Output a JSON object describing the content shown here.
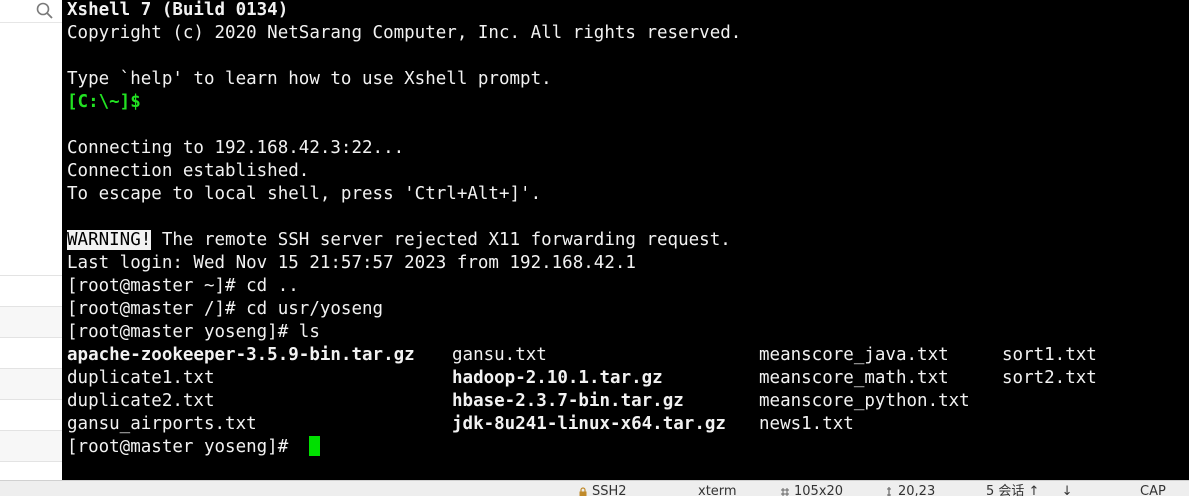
{
  "side_panel": {
    "search_icon": "search-icon"
  },
  "terminal": {
    "lines": [
      {
        "text": "Xshell 7 (Build 0134)"
      },
      {
        "text": "Copyright (c) 2020 NetSarang Computer, Inc. All rights reserved."
      },
      {
        "text": ""
      },
      {
        "text": "Type `help' to learn how to use Xshell prompt."
      },
      {
        "text": "[C:\\~]$"
      },
      {
        "text": ""
      },
      {
        "text": "Connecting to 192.168.42.3:22..."
      },
      {
        "text": "Connection established."
      },
      {
        "text": "To escape to local shell, press 'Ctrl+Alt+]'."
      },
      {
        "text": ""
      },
      {
        "warning": "WARNING!",
        "text": " The remote SSH server rejected X11 forwarding request."
      },
      {
        "text": "Last login: Wed Nov 15 21:57:57 2023 from 192.168.42.1"
      },
      {
        "text": "[root@master ~]# cd .."
      },
      {
        "text": "[root@master /]# cd usr/yoseng"
      },
      {
        "text": "[root@master yoseng]# ls"
      }
    ],
    "ls_output": {
      "col1": [
        "apache-zookeeper-3.5.9-bin.tar.gz",
        "duplicate1.txt",
        "duplicate2.txt",
        "gansu_airports.txt"
      ],
      "col2": [
        "gansu.txt",
        "hadoop-2.10.1.tar.gz",
        "hbase-2.3.7-bin.tar.gz",
        "jdk-8u241-linux-x64.tar.gz"
      ],
      "col3": [
        "meanscore_java.txt",
        "meanscore_math.txt",
        "meanscore_python.txt",
        "news1.txt"
      ],
      "col4": [
        "sort1.txt",
        "sort2.txt"
      ]
    },
    "final_prompt": "[root@master yoseng]# ",
    "colors": {
      "background": "#000000",
      "foreground": "#f2f2f2",
      "prompt_green": "#22e222",
      "archive_red": "#ff4040",
      "cursor": "#00e000"
    }
  },
  "status_bar": {
    "items": [
      "SSH2",
      "xterm",
      "105x20",
      "20,23",
      "5 会话",
      "CAP"
    ]
  }
}
